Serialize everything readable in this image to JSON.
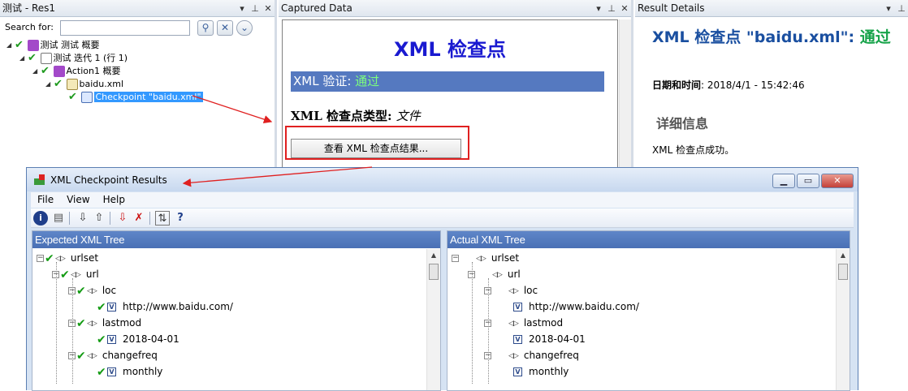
{
  "left_pane": {
    "title": "测试 - Res1",
    "controls": [
      "▾",
      "⊥",
      "✕"
    ],
    "search_label": "Search for:",
    "search_placeholder": "",
    "tree": [
      {
        "label": "测试 测试 概要"
      },
      {
        "label": "测试 迭代 1 (行 1)"
      },
      {
        "label": "Action1 概要"
      },
      {
        "label": "baidu.xml"
      },
      {
        "label": "Checkpoint \"baidu.xml\""
      }
    ]
  },
  "center_pane": {
    "title": "Captured Data",
    "controls": [
      "▾",
      "⊥",
      "✕"
    ],
    "heading": "XML 检查点",
    "verify_label": "XML 验证: ",
    "verify_status": "通过",
    "type_label": "XML 检查点类型: ",
    "type_value": "文件",
    "view_button": "查看  XML 检查点结果..."
  },
  "right_pane": {
    "title": "Result Details",
    "controls": [
      "▾",
      "⊥"
    ],
    "heading_prefix": "XML 检查点  \"baidu.xml\": ",
    "heading_status": "通过",
    "date_label": "日期和时间",
    "date_value": ": 2018/4/1 - 15:42:46",
    "details_heading": "详细信息",
    "details_message": "XML 检查点成功。"
  },
  "popup": {
    "title": "XML Checkpoint Results",
    "menu": [
      "File",
      "View",
      "Help"
    ],
    "expected_title": "Expected XML Tree",
    "actual_title": "Actual XML Tree",
    "expected_tree": [
      {
        "label": "urlset"
      },
      {
        "label": "url"
      },
      {
        "label": "loc"
      },
      {
        "label": "http://www.baidu.com/"
      },
      {
        "label": "lastmod"
      },
      {
        "label": "2018-04-01"
      },
      {
        "label": "changefreq"
      },
      {
        "label": "monthly"
      }
    ],
    "actual_tree": [
      {
        "label": "urlset"
      },
      {
        "label": "url"
      },
      {
        "label": "loc"
      },
      {
        "label": "http://www.baidu.com/"
      },
      {
        "label": "lastmod"
      },
      {
        "label": "2018-04-01"
      },
      {
        "label": "changefreq"
      },
      {
        "label": "monthly"
      }
    ]
  },
  "colors": {
    "accent_blue": "#4a70b5",
    "pass_green": "#17a34a",
    "title_blue": "#1a1ad0",
    "annotation_red": "#e02020"
  }
}
